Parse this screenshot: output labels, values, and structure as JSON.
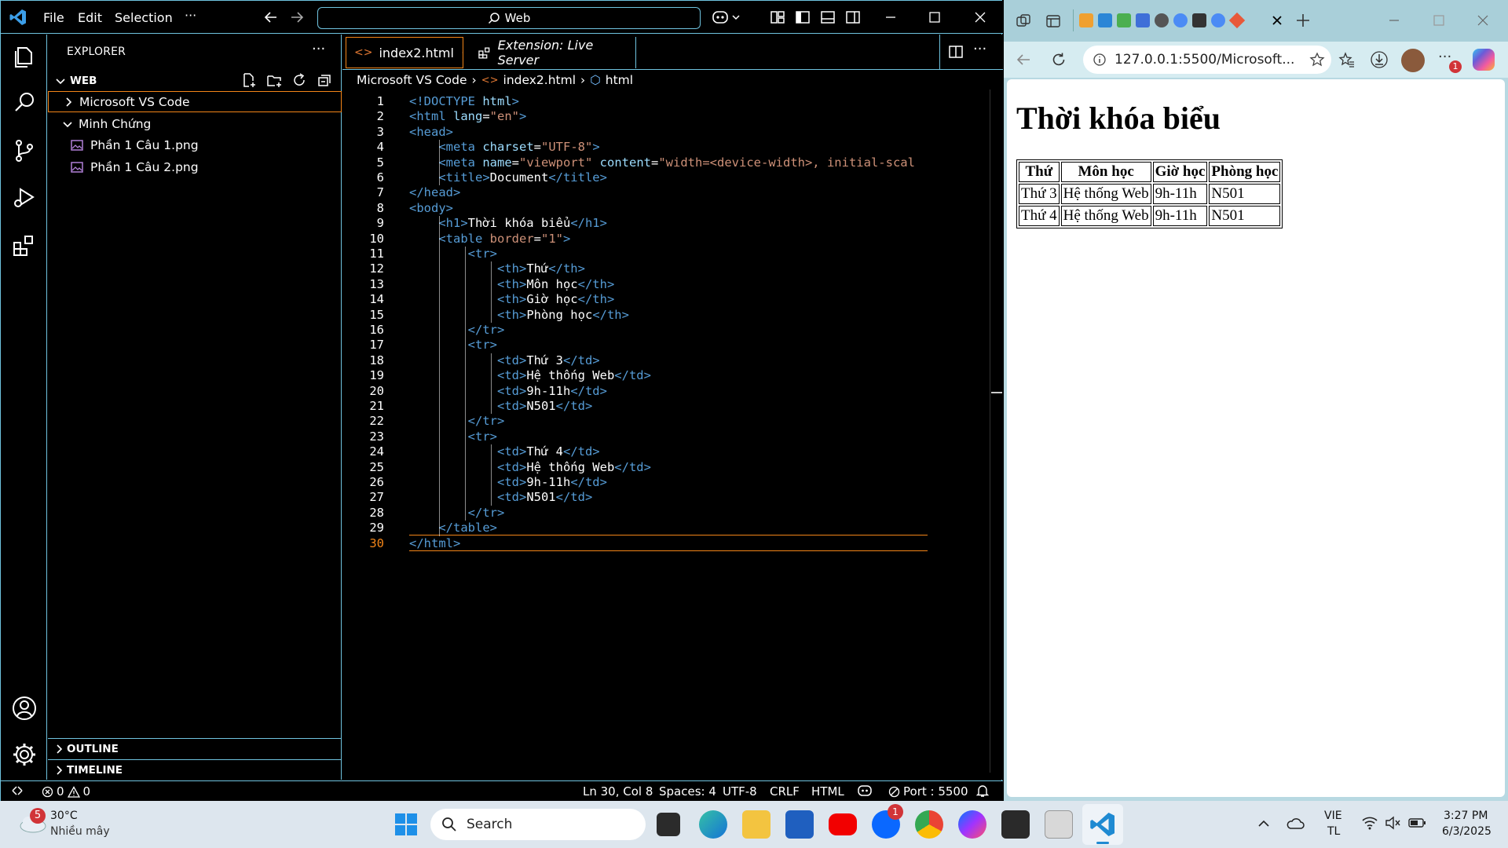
{
  "vscode": {
    "menu": [
      "File",
      "Edit",
      "Selection",
      "···"
    ],
    "command_center": "Web",
    "explorer_title": "EXPLORER",
    "workspace": "WEB",
    "tree": [
      {
        "label": "Microsoft VS Code",
        "type": "folder",
        "expanded": false
      },
      {
        "label": "Minh Chứng",
        "type": "folder",
        "expanded": true
      },
      {
        "label": "Phần 1 Câu 1.png",
        "type": "file"
      },
      {
        "label": "Phần 1 Câu 2.png",
        "type": "file"
      }
    ],
    "outline": "OUTLINE",
    "timeline": "TIMELINE",
    "tabs": [
      {
        "label": "index2.html",
        "active": true
      },
      {
        "label": "Extension: Live Server",
        "active": false
      }
    ],
    "breadcrumb": [
      "Microsoft VS Code",
      "index2.html",
      "html"
    ],
    "code_lines": [
      [
        [
          "t",
          "<!DOCTYPE "
        ],
        [
          "a",
          "html"
        ],
        [
          "t",
          ">"
        ]
      ],
      [
        [
          "t",
          "<html "
        ],
        [
          "a",
          "lang"
        ],
        [
          "p",
          "="
        ],
        [
          "s",
          "\"en\""
        ],
        [
          "t",
          ">"
        ]
      ],
      [
        [
          "t",
          "<head>"
        ]
      ],
      [
        [
          "p",
          "    "
        ],
        [
          "t",
          "<meta "
        ],
        [
          "a",
          "charset"
        ],
        [
          "p",
          "="
        ],
        [
          "s",
          "\"UTF-8\""
        ],
        [
          "t",
          ">"
        ]
      ],
      [
        [
          "p",
          "    "
        ],
        [
          "t",
          "<meta "
        ],
        [
          "a",
          "name"
        ],
        [
          "p",
          "="
        ],
        [
          "s",
          "\"viewport\""
        ],
        [
          "p",
          " "
        ],
        [
          "a",
          "content"
        ],
        [
          "p",
          "="
        ],
        [
          "s",
          "\"width=<device-width>, initial-scal"
        ]
      ],
      [
        [
          "p",
          "    "
        ],
        [
          "t",
          "<title>"
        ],
        [
          "p",
          "Document"
        ],
        [
          "t",
          "</title>"
        ]
      ],
      [
        [
          "t",
          "</head>"
        ]
      ],
      [
        [
          "t",
          "<body>"
        ]
      ],
      [
        [
          "p",
          "    "
        ],
        [
          "t",
          "<h1>"
        ],
        [
          "p",
          "Thời khóa biểu"
        ],
        [
          "t",
          "</h1>"
        ]
      ],
      [
        [
          "p",
          "    "
        ],
        [
          "t",
          "<table "
        ],
        [
          "s",
          "border"
        ],
        [
          "p",
          "="
        ],
        [
          "s",
          "\"1\""
        ],
        [
          "t",
          ">"
        ]
      ],
      [
        [
          "p",
          "        "
        ],
        [
          "t",
          "<tr>"
        ]
      ],
      [
        [
          "p",
          "            "
        ],
        [
          "t",
          "<th>"
        ],
        [
          "p",
          "Thứ"
        ],
        [
          "t",
          "</th>"
        ]
      ],
      [
        [
          "p",
          "            "
        ],
        [
          "t",
          "<th>"
        ],
        [
          "p",
          "Môn học"
        ],
        [
          "t",
          "</th>"
        ]
      ],
      [
        [
          "p",
          "            "
        ],
        [
          "t",
          "<th>"
        ],
        [
          "p",
          "Giờ học"
        ],
        [
          "t",
          "</th>"
        ]
      ],
      [
        [
          "p",
          "            "
        ],
        [
          "t",
          "<th>"
        ],
        [
          "p",
          "Phòng học"
        ],
        [
          "t",
          "</th>"
        ]
      ],
      [
        [
          "p",
          "        "
        ],
        [
          "t",
          "</tr>"
        ]
      ],
      [
        [
          "p",
          "        "
        ],
        [
          "t",
          "<tr>"
        ]
      ],
      [
        [
          "p",
          "            "
        ],
        [
          "t",
          "<td>"
        ],
        [
          "p",
          "Thứ 3"
        ],
        [
          "t",
          "</td>"
        ]
      ],
      [
        [
          "p",
          "            "
        ],
        [
          "t",
          "<td>"
        ],
        [
          "p",
          "Hệ thống Web"
        ],
        [
          "t",
          "</td>"
        ]
      ],
      [
        [
          "p",
          "            "
        ],
        [
          "t",
          "<td>"
        ],
        [
          "p",
          "9h-11h"
        ],
        [
          "t",
          "</td>"
        ]
      ],
      [
        [
          "p",
          "            "
        ],
        [
          "t",
          "<td>"
        ],
        [
          "p",
          "N501"
        ],
        [
          "t",
          "</td>"
        ]
      ],
      [
        [
          "p",
          "        "
        ],
        [
          "t",
          "</tr>"
        ]
      ],
      [
        [
          "p",
          "        "
        ],
        [
          "t",
          "<tr>"
        ]
      ],
      [
        [
          "p",
          "            "
        ],
        [
          "t",
          "<td>"
        ],
        [
          "p",
          "Thứ 4"
        ],
        [
          "t",
          "</td>"
        ]
      ],
      [
        [
          "p",
          "            "
        ],
        [
          "t",
          "<td>"
        ],
        [
          "p",
          "Hệ thống Web"
        ],
        [
          "t",
          "</td>"
        ]
      ],
      [
        [
          "p",
          "            "
        ],
        [
          "t",
          "<td>"
        ],
        [
          "p",
          "9h-11h"
        ],
        [
          "t",
          "</td>"
        ]
      ],
      [
        [
          "p",
          "            "
        ],
        [
          "t",
          "<td>"
        ],
        [
          "p",
          "N501"
        ],
        [
          "t",
          "</td>"
        ]
      ],
      [
        [
          "p",
          "        "
        ],
        [
          "t",
          "</tr>"
        ]
      ],
      [
        [
          "p",
          "    "
        ],
        [
          "t",
          "</table>"
        ]
      ],
      [
        [
          "t",
          "</html>"
        ]
      ]
    ],
    "current_line": 30,
    "status": {
      "errors": "0",
      "warnings": "0",
      "position": "Ln 30, Col 8",
      "spaces": "Spaces: 4",
      "encoding": "UTF-8",
      "eol": "CRLF",
      "language": "HTML",
      "port": "Port : 5500"
    }
  },
  "edge": {
    "url": "127.0.0.1:5500/Microsoft...",
    "notification_badge": "1",
    "page_heading": "Thời khóa biểu",
    "table_headers": [
      "Thứ",
      "Môn học",
      "Giờ học",
      "Phòng học"
    ],
    "table_rows": [
      [
        "Thứ 3",
        "Hệ thống Web",
        "9h-11h",
        "N501"
      ],
      [
        "Thứ 4",
        "Hệ thống Web",
        "9h-11h",
        "N501"
      ]
    ]
  },
  "taskbar": {
    "weather_badge": "5",
    "temperature": "30°C",
    "weather_desc": "Nhiều mây",
    "search_label": "Search",
    "zalo_badge": "1",
    "lang_top": "VIE",
    "lang_bottom": "TL",
    "time": "3:27 PM",
    "date": "6/3/2025"
  },
  "colors": {
    "hc_border": "#6fc3df",
    "tag": "#569cd6",
    "attr": "#9cdcfe",
    "string": "#ce9178",
    "current_line": "#f38518"
  }
}
